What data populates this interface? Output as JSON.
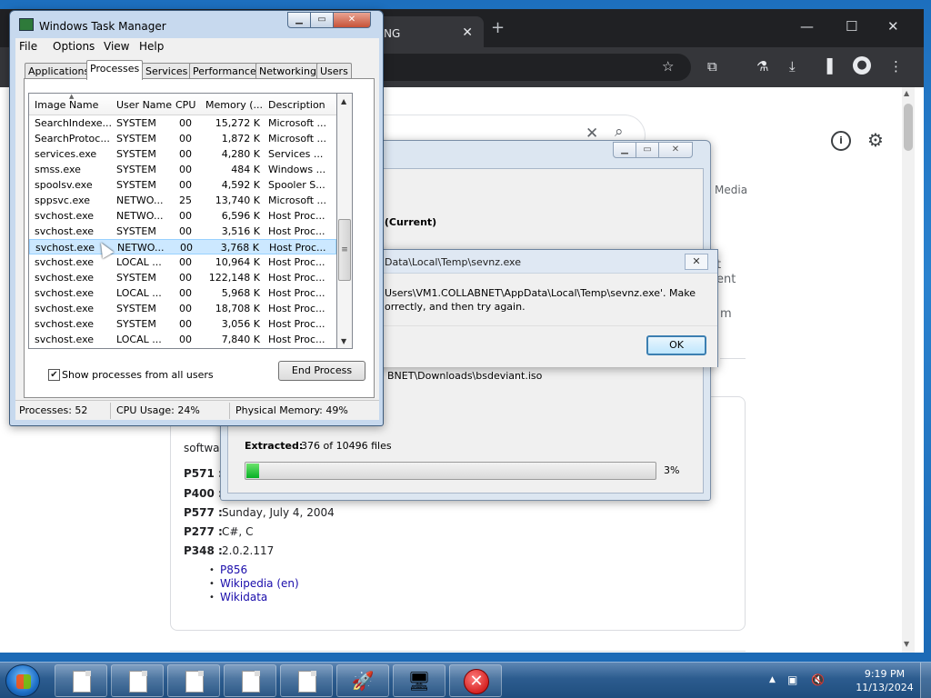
{
  "browser": {
    "tab_title": "NG",
    "tab_close": "✕",
    "new_tab": "+",
    "window_controls": [
      "—",
      "☐",
      "✕"
    ],
    "panel_fragments": {
      "media": "Media",
      "frag1": "t",
      "frag2": "ent",
      "frag3": "m"
    },
    "search_clear": "✕",
    "search_icon": "search-icon",
    "info_icon": "i",
    "settings_icon": "⚙"
  },
  "knowledge_panel": {
    "software_label": "softwar",
    "facts": [
      {
        "key": "P571 :",
        "value": ""
      },
      {
        "key": "P400 :",
        "value": ""
      },
      {
        "key": "P577 :",
        "value": "Sunday, July 4, 2004"
      },
      {
        "key": "P277 :",
        "value": "C#, C"
      },
      {
        "key": "P348 :",
        "value": "2.0.2.117"
      }
    ],
    "links": [
      "P856",
      "Wikipedia (en)",
      "Wikidata"
    ]
  },
  "extract_dialog": {
    "heading_fragment": "es (Current)",
    "path_fragment": "BNET\\Downloads\\bsdeviant.iso",
    "extracted_label": "Extracted:",
    "extracted_value": "376 of 10496 files",
    "progress_percent_text": "3%",
    "progress_value": 0.03
  },
  "error_dialog": {
    "title_fragment": "Data\\Local\\Temp\\sevnz.exe",
    "message_line1": "Users\\VM1.COLLABNET\\AppData\\Local\\Temp\\sevnz.exe'. Make",
    "message_line2": "orrectly, and then try again.",
    "ok_label": "OK"
  },
  "task_manager": {
    "title": "Windows Task Manager",
    "menu": [
      "File",
      "Options",
      "View",
      "Help"
    ],
    "tabs": [
      "Applications",
      "Processes",
      "Services",
      "Performance",
      "Networking",
      "Users"
    ],
    "active_tab": "Processes",
    "columns": [
      "Image Name",
      "User Name",
      "CPU",
      "Memory (...",
      "Description"
    ],
    "rows": [
      {
        "name": "SearchIndexe...",
        "user": "SYSTEM",
        "cpu": "00",
        "mem": "15,272 K",
        "desc": "Microsoft ..."
      },
      {
        "name": "SearchProtoc...",
        "user": "SYSTEM",
        "cpu": "00",
        "mem": "1,872 K",
        "desc": "Microsoft ..."
      },
      {
        "name": "services.exe",
        "user": "SYSTEM",
        "cpu": "00",
        "mem": "4,280 K",
        "desc": "Services ..."
      },
      {
        "name": "smss.exe",
        "user": "SYSTEM",
        "cpu": "00",
        "mem": "484 K",
        "desc": "Windows ..."
      },
      {
        "name": "spoolsv.exe",
        "user": "SYSTEM",
        "cpu": "00",
        "mem": "4,592 K",
        "desc": "Spooler S..."
      },
      {
        "name": "sppsvc.exe",
        "user": "NETWO...",
        "cpu": "25",
        "mem": "13,740 K",
        "desc": "Microsoft ..."
      },
      {
        "name": "svchost.exe",
        "user": "NETWO...",
        "cpu": "00",
        "mem": "6,596 K",
        "desc": "Host Proc..."
      },
      {
        "name": "svchost.exe",
        "user": "SYSTEM",
        "cpu": "00",
        "mem": "3,516 K",
        "desc": "Host Proc..."
      },
      {
        "name": "svchost.exe",
        "user": "NETWO...",
        "cpu": "00",
        "mem": "3,768 K",
        "desc": "Host Proc..."
      },
      {
        "name": "svchost.exe",
        "user": "LOCAL ...",
        "cpu": "00",
        "mem": "10,964 K",
        "desc": "Host Proc..."
      },
      {
        "name": "svchost.exe",
        "user": "SYSTEM",
        "cpu": "00",
        "mem": "122,148 K",
        "desc": "Host Proc..."
      },
      {
        "name": "svchost.exe",
        "user": "LOCAL ...",
        "cpu": "00",
        "mem": "5,968 K",
        "desc": "Host Proc..."
      },
      {
        "name": "svchost.exe",
        "user": "SYSTEM",
        "cpu": "00",
        "mem": "18,708 K",
        "desc": "Host Proc..."
      },
      {
        "name": "svchost.exe",
        "user": "SYSTEM",
        "cpu": "00",
        "mem": "3,056 K",
        "desc": "Host Proc..."
      },
      {
        "name": "svchost.exe",
        "user": "LOCAL ...",
        "cpu": "00",
        "mem": "7,840 K",
        "desc": "Host Proc..."
      }
    ],
    "selected_row": 8,
    "show_all_label": "Show processes from all users",
    "show_all_checked": true,
    "end_process_label": "End Process",
    "status": {
      "processes": "Processes: 52",
      "cpu": "CPU Usage: 24%",
      "memory": "Physical Memory: 49%"
    }
  },
  "taskbar": {
    "time": "9:19 PM",
    "date": "11/13/2024",
    "tray_arrow": "▲"
  }
}
